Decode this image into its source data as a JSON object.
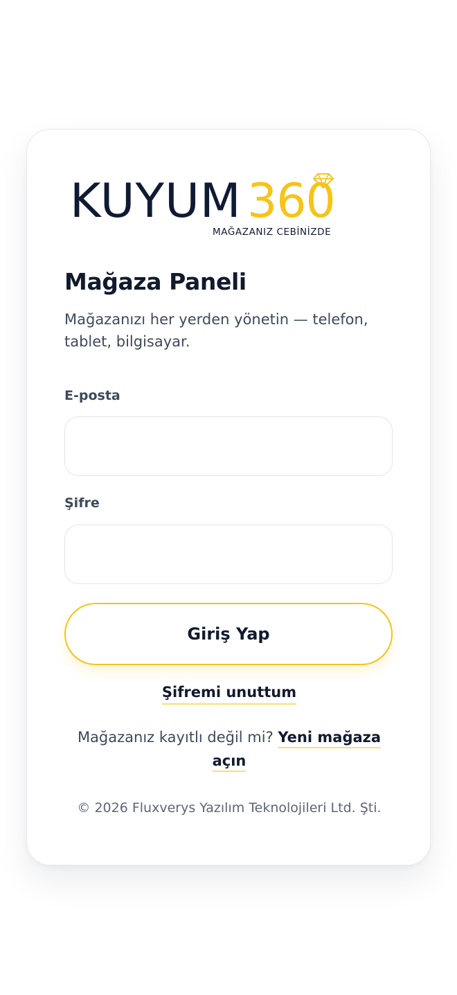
{
  "brand": {
    "word": "KUYUM",
    "number": "360",
    "tagline": "MAĞAZANIZ CEBİNİZDE",
    "primary_color": "#101a33",
    "accent_color": "#f6c418"
  },
  "header": {
    "title": "Mağaza Paneli",
    "subtitle": "Mağazanızı her yerden yönetin — telefon, tablet, bilgisayar."
  },
  "form": {
    "email_label": "E-posta",
    "email_value": "",
    "password_label": "Şifre",
    "password_value": "",
    "submit_label": "Giriş Yap"
  },
  "links": {
    "forgot_password": "Şifremi unuttum",
    "register_prompt": "Mağazanız kayıtlı değil mi?",
    "register_link": "Yeni mağaza açın"
  },
  "footer": {
    "copyright": "© 2026 Fluxverys Yazılım Teknolojileri Ltd. Şti."
  }
}
